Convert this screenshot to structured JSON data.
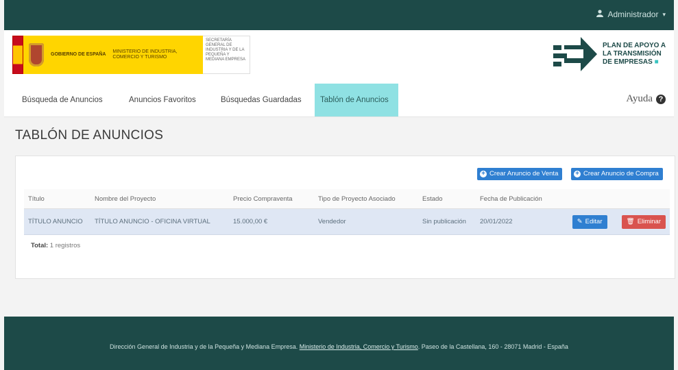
{
  "topbar": {
    "user_label": "Administrador"
  },
  "header": {
    "gov_line1": "GOBIERNO DE ESPAÑA",
    "gov_line2": "MINISTERIO DE INDUSTRIA, COMERCIO Y TURISMO",
    "gov_side_text": "SECRETARÍA GENERAL DE INDUSTRIA Y DE LA PEQUEÑA Y MEDIANA EMPRESA",
    "plan_line1": "PLAN DE APOYO A",
    "plan_line2": "LA TRANSMISIÓN",
    "plan_line3": "DE EMPRESAS"
  },
  "nav": {
    "tabs": [
      {
        "label": "Búsqueda de Anuncios"
      },
      {
        "label": "Anuncios Favoritos"
      },
      {
        "label": "Búsquedas Guardadas"
      },
      {
        "label": "Tablón de Anuncios"
      }
    ],
    "active_tab": "Tablón de Anuncios",
    "help_label": "Ayuda"
  },
  "page": {
    "title": "TABLÓN DE ANUNCIOS"
  },
  "actions": {
    "create_seller": "Crear Anuncio de Venta",
    "create_buyer": "Crear Anuncio de Compra"
  },
  "table": {
    "headers": [
      "Título",
      "Nombre del Proyecto",
      "Precio Compraventa",
      "Tipo de Proyecto Asociado",
      "Estado",
      "Fecha de Publicación"
    ],
    "rows": [
      {
        "cells": [
          "TÍTULO ANUNCIO",
          "TÍTULO ANUNCIO - OFICINA VIRTUAL",
          "15.000,00 €",
          "Vendedor",
          "Sin publicación",
          "20/01/2022"
        ],
        "edit_label": "Editar",
        "delete_label": "Eliminar"
      }
    ]
  },
  "footer_total": {
    "label": "Total:",
    "value": "1 registros"
  },
  "footer": {
    "text_before": "Dirección General de Industria y de la Pequeña y Mediana Empresa.",
    "link": "Ministerio de Industria, Comercio y Turismo",
    "text_after": "Paseo de la Castellana, 160 - 28071 Madrid - España"
  },
  "colors": {
    "brand_dark": "#1d4a48",
    "active_tab": "#8fe1e3",
    "primary_button": "#2f7fd1",
    "danger_button": "#d9534f",
    "selected_row": "#dfe7f4"
  }
}
